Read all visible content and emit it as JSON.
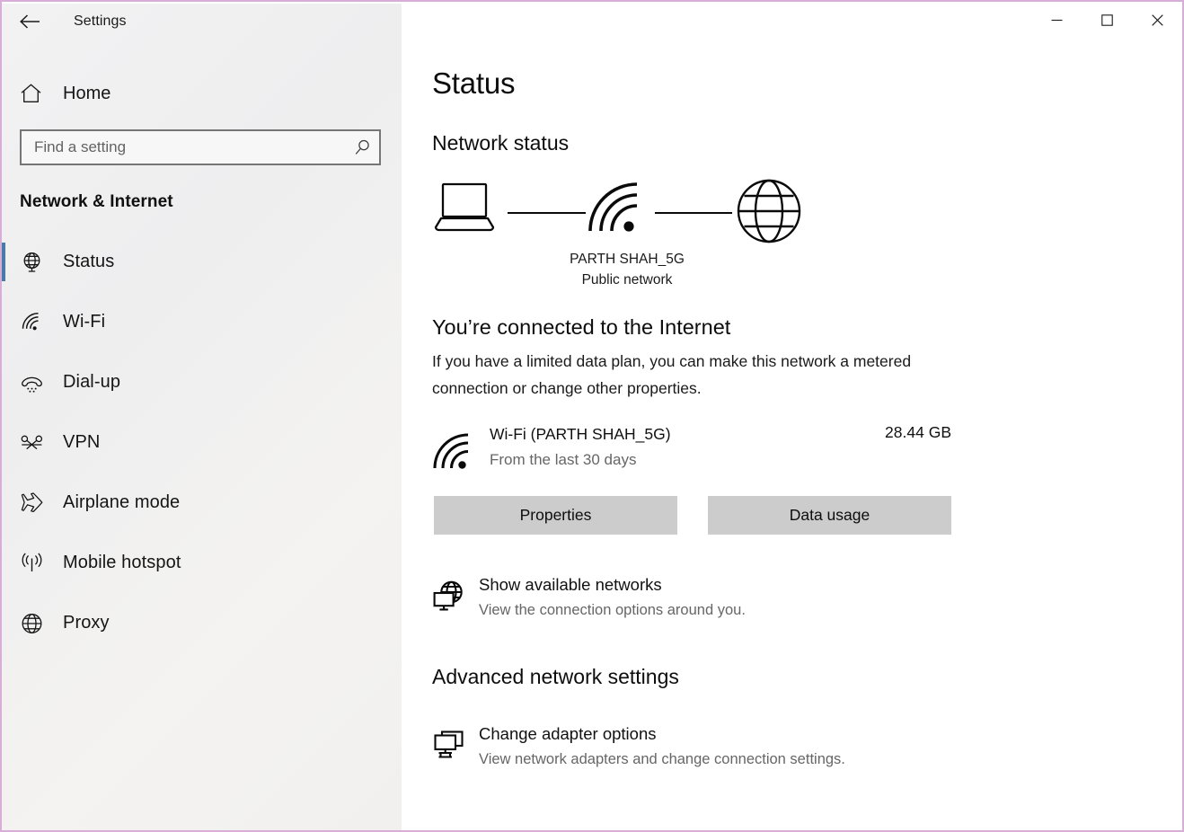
{
  "window": {
    "app_title": "Settings",
    "back_icon": "back-arrow-icon",
    "controls": {
      "minimize": "minimize-icon",
      "maximize": "maximize-icon",
      "close": "close-icon"
    },
    "border_color": "#d8aed8"
  },
  "sidebar": {
    "home_label": "Home",
    "home_icon": "home-icon",
    "search": {
      "placeholder": "Find a setting",
      "value": "",
      "icon": "search-icon"
    },
    "category_title": "Network & Internet",
    "selection_color": "#4a7ba8",
    "items": [
      {
        "label": "Status",
        "icon": "globe-monitor-icon",
        "selected": true
      },
      {
        "label": "Wi-Fi",
        "icon": "wifi-icon",
        "selected": false
      },
      {
        "label": "Dial-up",
        "icon": "phone-handset-icon",
        "selected": false
      },
      {
        "label": "VPN",
        "icon": "vpn-icon",
        "selected": false
      },
      {
        "label": "Airplane mode",
        "icon": "airplane-icon",
        "selected": false
      },
      {
        "label": "Mobile hotspot",
        "icon": "hotspot-icon",
        "selected": false
      },
      {
        "label": "Proxy",
        "icon": "globe-icon",
        "selected": false
      }
    ]
  },
  "main": {
    "page_title": "Status",
    "network_status_heading": "Network status",
    "diagram": {
      "device_icon": "laptop-icon",
      "connection_icon": "wifi-icon",
      "internet_icon": "globe-icon",
      "network_name": "PARTH SHAH_5G",
      "network_type": "Public network"
    },
    "connected_heading": "You’re connected to the Internet",
    "connected_description": "If you have a limited data plan, you can make this network a metered connection or change other properties.",
    "adapter": {
      "icon": "wifi-icon",
      "name": "Wi-Fi (PARTH SHAH_5G)",
      "subtitle": "From the last 30 days",
      "usage": "28.44 GB"
    },
    "buttons": {
      "properties": "Properties",
      "data_usage": "Data usage"
    },
    "show_networks": {
      "icon": "globe-monitor-icon",
      "title": "Show available networks",
      "subtitle": "View the connection options around you."
    },
    "advanced_heading": "Advanced network settings",
    "change_adapter": {
      "icon": "network-adapters-icon",
      "title": "Change adapter options",
      "subtitle": "View network adapters and change connection settings."
    }
  }
}
